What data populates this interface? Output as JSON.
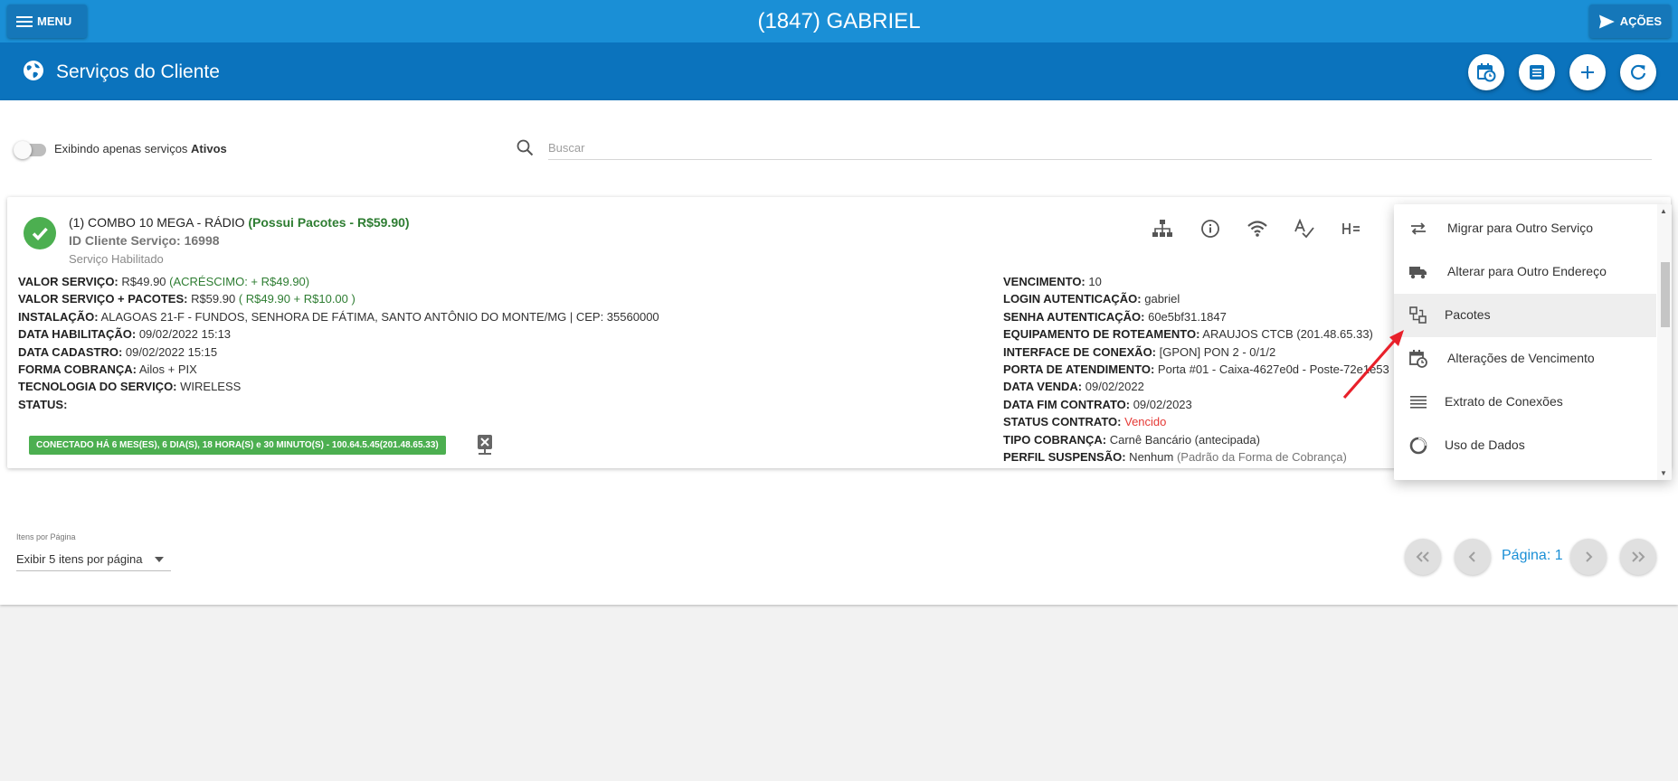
{
  "topbar": {
    "menu_label": "MENU",
    "title": "(1847) GABRIEL",
    "actions_label": "AÇÕES"
  },
  "header": {
    "title": "Serviços do Cliente"
  },
  "filter": {
    "toggle_text": "Exibindo apenas serviços ",
    "toggle_bold": "Ativos",
    "search_placeholder": "Buscar"
  },
  "service": {
    "name": "(1) COMBO 10 MEGA - RÁDIO ",
    "packages": "(Possui Pacotes - R$59.90)",
    "id_line": "ID Cliente Serviço: 16998",
    "status_text": "Serviço Habilitado",
    "left_rows": [
      {
        "label": "VALOR SERVIÇO:",
        "value": " R$49.90 ",
        "extra": "(ACRÉSCIMO: + R$49.90)"
      },
      {
        "label": "VALOR SERVIÇO + PACOTES:",
        "value": " R$59.90 ",
        "extra": "( R$49.90 + R$10.00 )"
      },
      {
        "label": "INSTALAÇÃO:",
        "value": " ALAGOAS 21-F - FUNDOS, SENHORA DE FÁTIMA, SANTO ANTÔNIO DO MONTE/MG | CEP: 35560000",
        "extra": ""
      },
      {
        "label": "DATA HABILITAÇÃO:",
        "value": " 09/02/2022 15:13",
        "extra": ""
      },
      {
        "label": "DATA CADASTRO:",
        "value": " 09/02/2022 15:15",
        "extra": ""
      },
      {
        "label": "FORMA COBRANÇA:",
        "value": " Ailos + PIX",
        "extra": ""
      },
      {
        "label": "TECNOLOGIA DO SERVIÇO:",
        "value": " WIRELESS",
        "extra": ""
      },
      {
        "label": "STATUS:",
        "value": "",
        "extra": ""
      }
    ],
    "right_rows": [
      {
        "label": "VENCIMENTO:",
        "value": " 10"
      },
      {
        "label": "LOGIN AUTENTICAÇÃO:",
        "value": " gabriel"
      },
      {
        "label": "SENHA AUTENTICAÇÃO:",
        "value": " 60e5bf31.1847"
      },
      {
        "label": "EQUIPAMENTO DE ROTEAMENTO:",
        "value": " ARAUJOS CTCB (201.48.65.33)"
      },
      {
        "label": "INTERFACE DE CONEXÃO:",
        "value": " [GPON] PON 2 - 0/1/2"
      },
      {
        "label": "PORTA DE ATENDIMENTO:",
        "value": " Porta #01 - Caixa-4627e0d - Poste-72e1e53"
      },
      {
        "label": "DATA VENDA:",
        "value": " 09/02/2022"
      },
      {
        "label": "DATA FIM CONTRATO:",
        "value": " 09/02/2023"
      },
      {
        "label": "STATUS CONTRATO:",
        "value": " ",
        "status": "Vencido"
      },
      {
        "label": "TIPO COBRANÇA:",
        "value": " Carnê Bancário (antecipada)"
      },
      {
        "label": "PERFIL SUSPENSÃO:",
        "value": " Nenhum ",
        "muted": "(Padrão da Forma de Cobrança)"
      }
    ],
    "connection_badge": "CONECTADO HÁ 6 MES(ES), 6 DIA(S), 18 HORA(S) e 30 MINUTO(S) - 100.64.5.45(201.48.65.33)"
  },
  "dropdown": {
    "items": [
      {
        "label": "Migrar para Outro Serviço",
        "icon": "swap-icon"
      },
      {
        "label": "Alterar para Outro Endereço",
        "icon": "truck-icon"
      },
      {
        "label": "Pacotes",
        "icon": "packages-icon"
      },
      {
        "label": "Alterações de Vencimento",
        "icon": "calendar-clock-icon"
      },
      {
        "label": "Extrato de Conexões",
        "icon": "list-lines-icon"
      },
      {
        "label": "Uso de Dados",
        "icon": "donut-icon"
      }
    ],
    "active_index": 2
  },
  "pagination": {
    "per_page_label": "Itens por Página",
    "per_page_value": "Exibir 5 itens por página",
    "page_label": "Página: 1"
  },
  "colors": {
    "topbar": "#1a8fd6",
    "header": "#0b73bd",
    "success": "#4caf50",
    "danger": "#e53935",
    "annotation_arrow": "#e8202a"
  }
}
